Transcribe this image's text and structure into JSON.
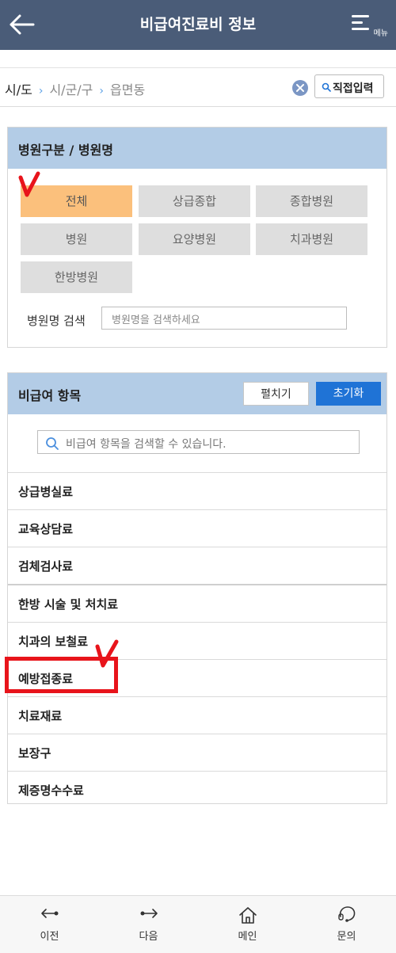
{
  "header": {
    "title": "비급여진료비 정보",
    "menu_label": "메뉴"
  },
  "breadcrumb": {
    "level1": "시/도",
    "level2": "시/군/구",
    "level3": "읍면동",
    "direct_input_label": "직접입력"
  },
  "hospital_panel": {
    "title": "병원구분 / 병원명",
    "categories": [
      "전체",
      "상급종합",
      "종합병원",
      "병원",
      "요양병원",
      "치과병원",
      "한방병원"
    ],
    "selected": "전체",
    "search_label": "병원명 검색",
    "search_placeholder": "병원명을 검색하세요"
  },
  "item_panel": {
    "title": "비급여 항목",
    "expand_label": "펼치기",
    "reset_label": "초기화",
    "search_placeholder": "비급여 항목을 검색할 수 있습니다.",
    "items": [
      "상급병실료",
      "교육상담료",
      "검체검사료",
      "한방 시술 및 처치료",
      "치과의 보철료",
      "예방접종료",
      "치료재료",
      "보장구",
      "제증명수수료"
    ],
    "highlighted": "예방접종료"
  },
  "bottom_nav": {
    "prev": "이전",
    "next": "다음",
    "main": "메인",
    "inquiry": "문의"
  },
  "colors": {
    "header_bg": "#4a5c78",
    "panel_head_bg": "#b3cce6",
    "active_category": "#fbc07c",
    "reset_button": "#1f73d6",
    "annotation_red": "#e8141b"
  }
}
